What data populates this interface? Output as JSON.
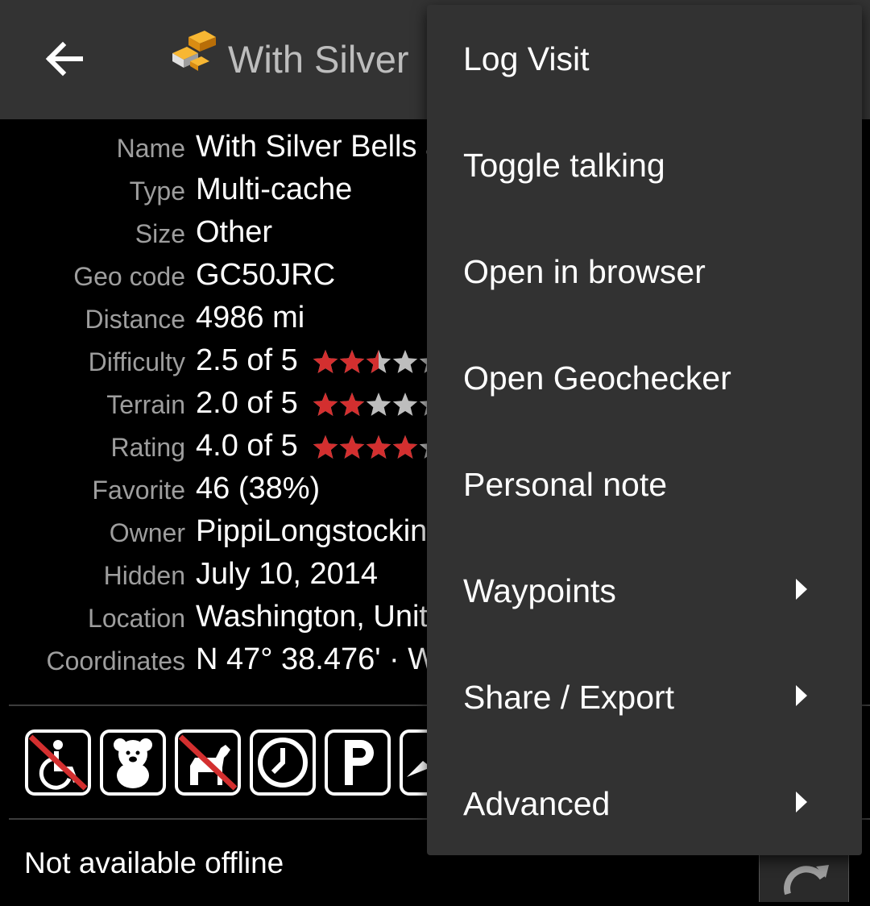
{
  "app_bar": {
    "title": "With Silver",
    "back_icon": "arrow-left-icon",
    "cache_icon": "multi-cache-icon"
  },
  "details": [
    {
      "label": "Name",
      "value": "With Silver Bells a"
    },
    {
      "label": "Type",
      "value": "Multi-cache"
    },
    {
      "label": "Size",
      "value": "Other"
    },
    {
      "label": "Geo code",
      "value": "GC50JRC"
    },
    {
      "label": "Distance",
      "value": "4986 mi"
    },
    {
      "label": "Difficulty",
      "value": "2.5 of 5",
      "stars": 2.5
    },
    {
      "label": "Terrain",
      "value": "2.0 of 5",
      "stars": 2.0
    },
    {
      "label": "Rating",
      "value": "4.0 of 5",
      "stars": 4.0
    },
    {
      "label": "Favorite",
      "value": "46 (38%)"
    },
    {
      "label": "Owner",
      "value": "PippiLongstockin"
    },
    {
      "label": "Hidden",
      "value": "July 10, 2014"
    },
    {
      "label": "Location",
      "value": "Washington, Unit"
    },
    {
      "label": "Coordinates",
      "value": "N 47° 38.476' · W"
    }
  ],
  "attributes": [
    {
      "icon": "no-wheelchair-icon"
    },
    {
      "icon": "kid-friendly-icon"
    },
    {
      "icon": "no-dogs-icon"
    },
    {
      "icon": "clock-icon"
    },
    {
      "icon": "parking-icon"
    },
    {
      "icon": "partial-attribute-icon"
    }
  ],
  "status": {
    "offline_text": "Not available offline",
    "refresh_icon": "refresh-icon"
  },
  "menu": {
    "items": [
      {
        "label": "Log Visit",
        "submenu": false
      },
      {
        "label": "Toggle talking",
        "submenu": false
      },
      {
        "label": "Open in browser",
        "submenu": false
      },
      {
        "label": "Open Geochecker",
        "submenu": false
      },
      {
        "label": "Personal note",
        "submenu": false
      },
      {
        "label": "Waypoints",
        "submenu": true
      },
      {
        "label": "Share / Export",
        "submenu": true
      },
      {
        "label": "Advanced",
        "submenu": true
      }
    ]
  },
  "colors": {
    "app_bar": "#333333",
    "menu_bg": "#323232",
    "star_filled": "#d32f2f",
    "star_empty": "#bdbdbd",
    "label_text": "#9e9e9e"
  }
}
